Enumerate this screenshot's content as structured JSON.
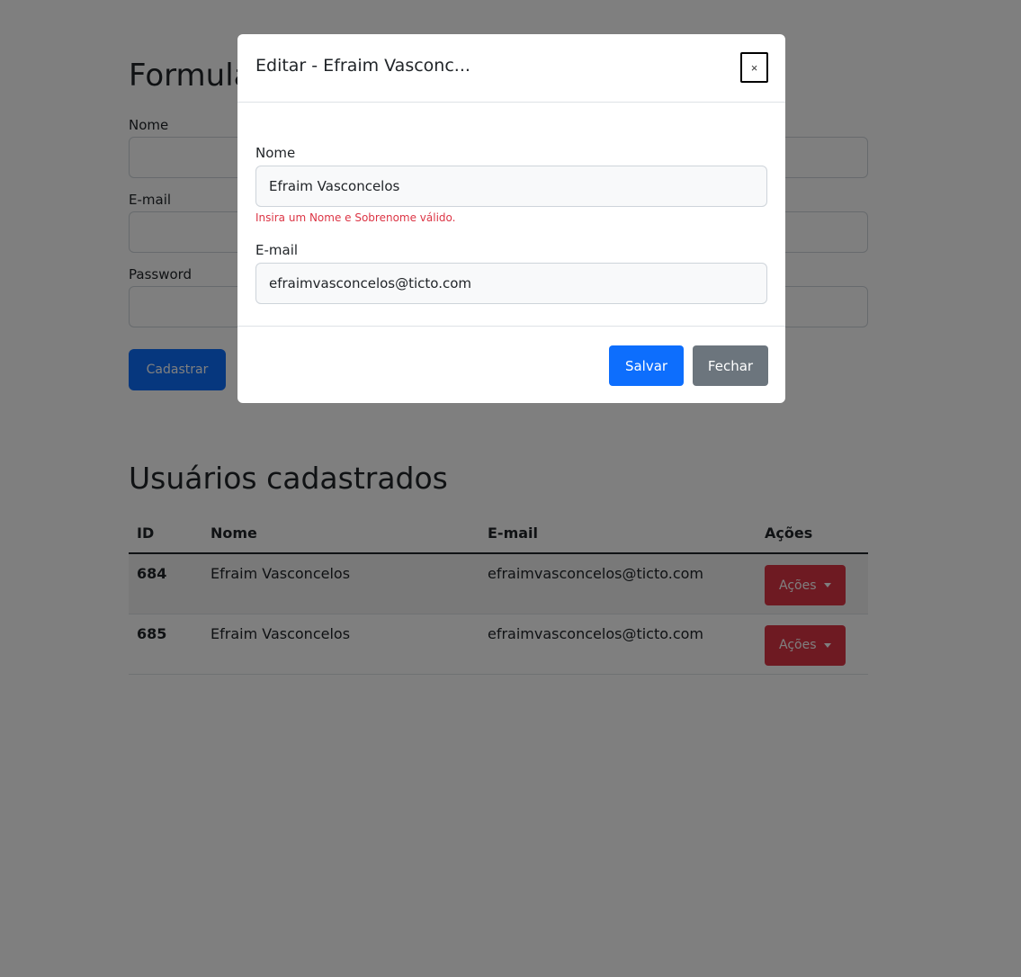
{
  "form": {
    "title": "Formulário de Cadastro",
    "fields": [
      {
        "label": "Nome"
      },
      {
        "label": "E-mail"
      },
      {
        "label": "Password"
      }
    ],
    "submit_label": "Cadastrar"
  },
  "users": {
    "title": "Usuários cadastrados",
    "columns": [
      "ID",
      "Nome",
      "E-mail",
      "Ações"
    ],
    "rows": [
      {
        "id": "684",
        "name": "Efraim Vasconcelos",
        "email": "efraimvasconcelos@ticto.com",
        "action_label": "Ações"
      },
      {
        "id": "685",
        "name": "Efraim Vasconcelos",
        "email": "efraimvasconcelos@ticto.com",
        "action_label": "Ações"
      }
    ]
  },
  "modal": {
    "title": "Editar - Efraim Vasconc...",
    "close_symbol": "×",
    "name_label": "Nome",
    "name_value": "Efraim Vasconcelos",
    "name_error": "Insira um Nome e Sobrenome válido.",
    "email_label": "E-mail",
    "email_value": "efraimvasconcelos@ticto.com",
    "save_label": "Salvar",
    "close_label": "Fechar"
  },
  "colors": {
    "primary": "#0d6efd",
    "danger": "#dc3545",
    "secondary": "#6c757d",
    "backdrop": "rgba(0,0,0,0.5)"
  },
  "icons": {
    "close": "close-icon",
    "dropdown": "caret-down-icon"
  }
}
